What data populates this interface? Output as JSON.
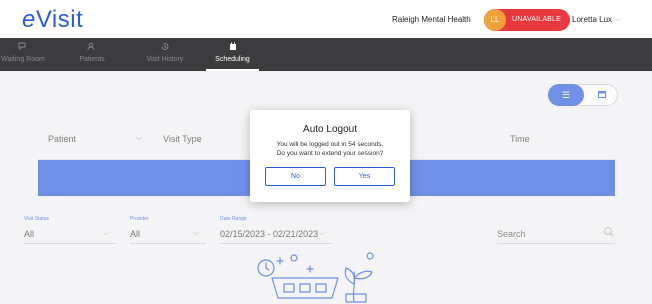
{
  "header": {
    "logo_first": "e",
    "logo_rest": "Visit",
    "organization": "Raleigh Mental Health",
    "avatar_initials": "LL",
    "availability_status": "UNAVAILABLE",
    "user_name": "Loretta Lux"
  },
  "nav": {
    "items": [
      {
        "label": "Waiting Room",
        "icon": "chat-bubbles-icon"
      },
      {
        "label": "Patients",
        "icon": "users-icon"
      },
      {
        "label": "Visit History",
        "icon": "history-icon"
      },
      {
        "label": "Scheduling",
        "icon": "calendar-icon",
        "active": true
      }
    ]
  },
  "table": {
    "columns": [
      "Patient",
      "Visit Type",
      "Time"
    ]
  },
  "filters": {
    "visit_status": {
      "label": "Visit Status",
      "value": "All"
    },
    "provider": {
      "label": "Provider",
      "value": "All"
    },
    "date_range": {
      "label": "Date Range",
      "value": "02/15/2023 - 02/21/2023"
    },
    "search_placeholder": "Search"
  },
  "dialog": {
    "title": "Auto Logout",
    "message_line1": "You will be logged out in 54 seconds.",
    "message_line2": "Do you want to extend your session?",
    "no_label": "No",
    "yes_label": "Yes"
  },
  "colors": {
    "accent": "#2a5adf",
    "nav_bg": "#3c3c3f",
    "status_red": "#e7383d",
    "avatar_orange": "#f0a13a"
  }
}
